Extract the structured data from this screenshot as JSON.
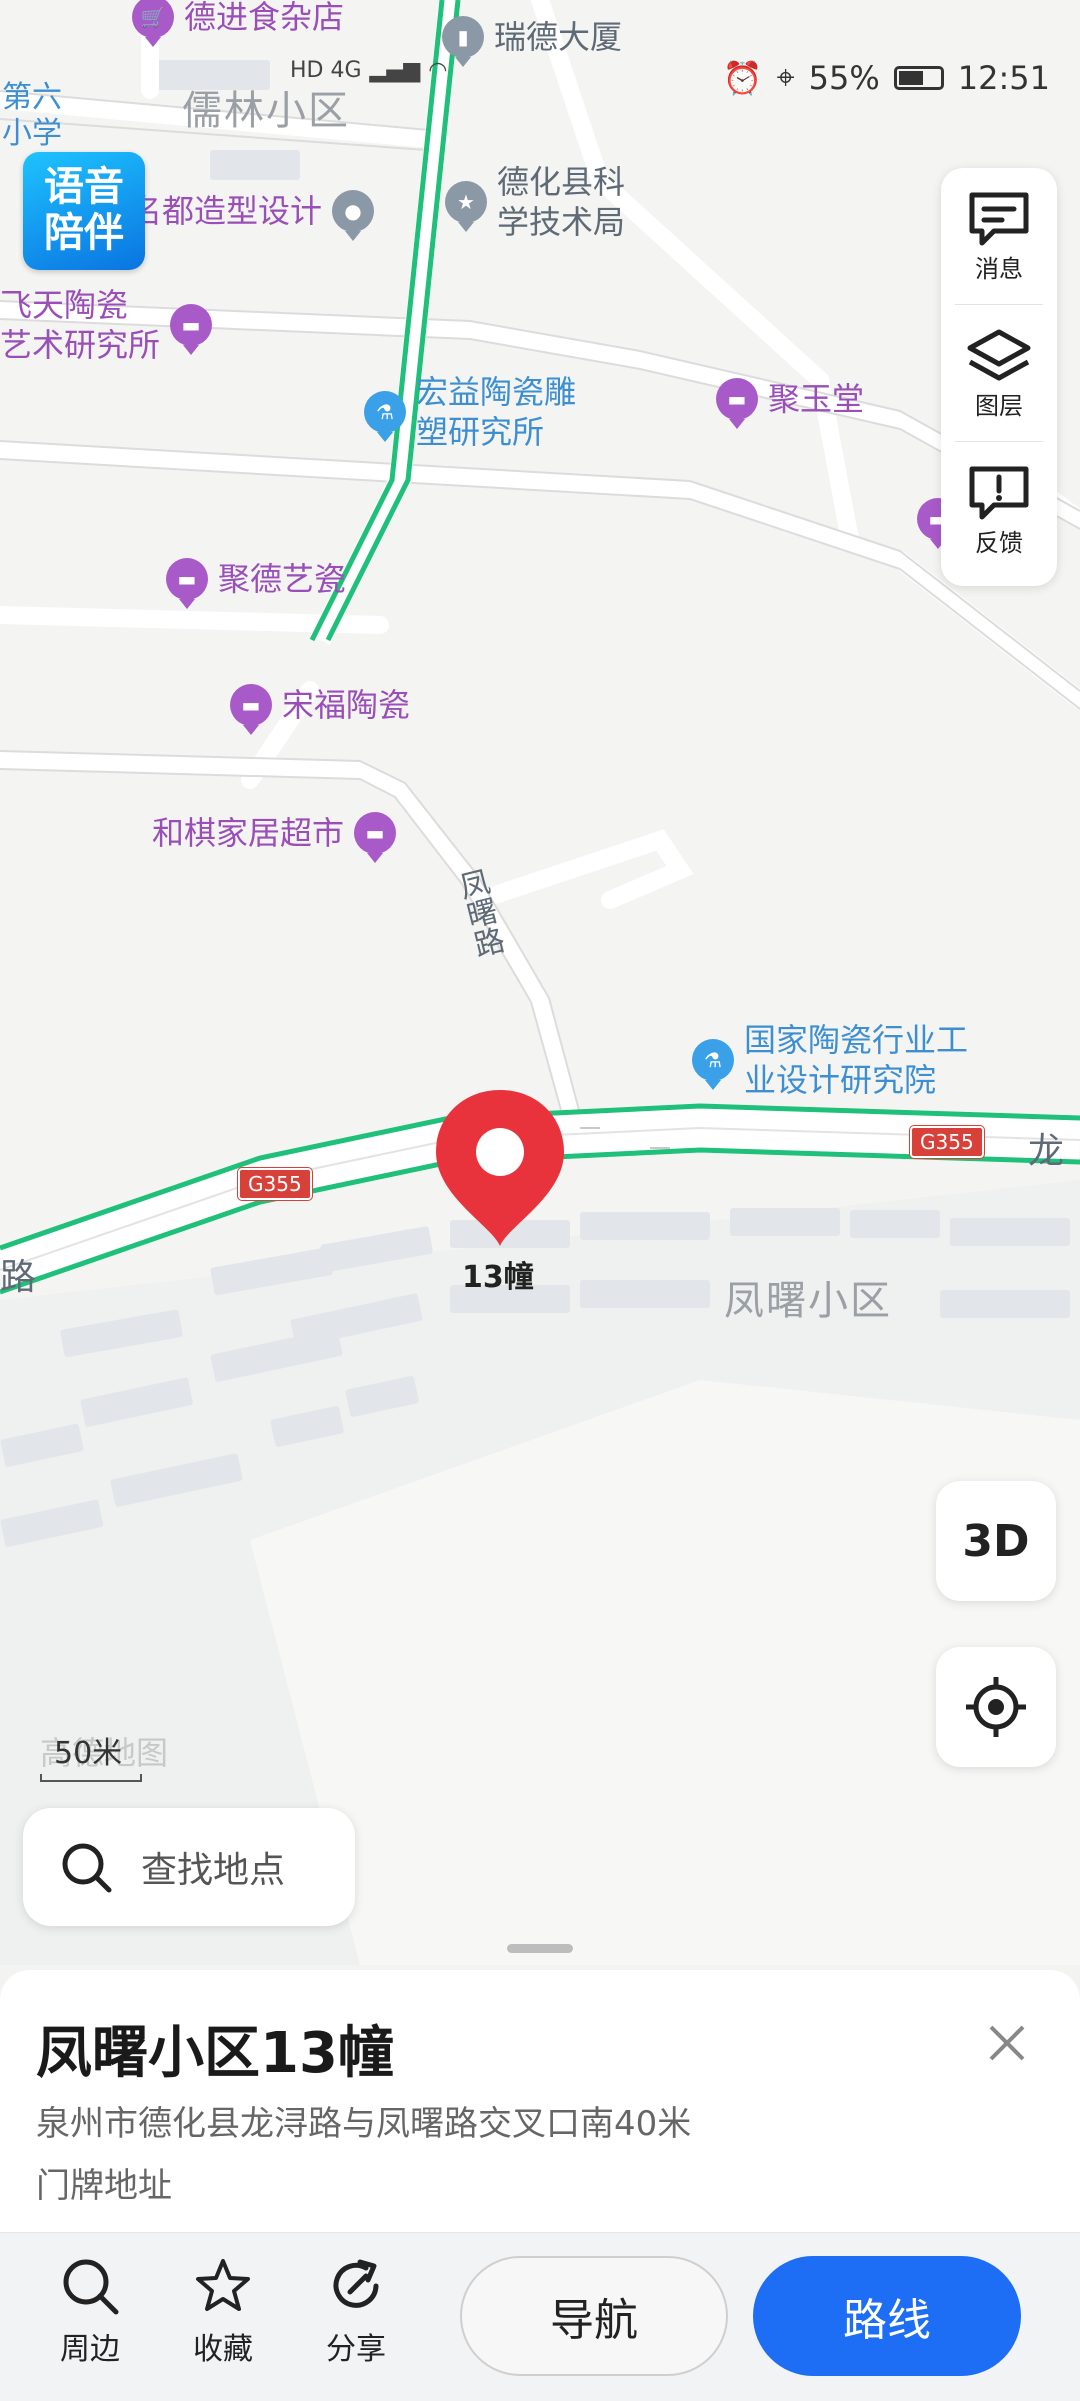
{
  "status_bar": {
    "network": "HD 4G",
    "battery": "55%",
    "time": "12:51"
  },
  "voice_companion": {
    "line1": "语音",
    "line2": "陪伴"
  },
  "right_panel": {
    "messages": "消息",
    "layers": "图层",
    "feedback": "反馈"
  },
  "map": {
    "pois": [
      {
        "name": "德进食杂店",
        "type": "shop"
      },
      {
        "name": "瑞德大厦",
        "type": "building"
      },
      {
        "name": "儒林小区",
        "type": "district"
      },
      {
        "name": "第六\n小学",
        "type": "school"
      },
      {
        "name": "名都造型设计",
        "type": "place"
      },
      {
        "name": "德化县科\n学技术局",
        "type": "gov"
      },
      {
        "name": "飞天陶瓷\n艺术研究所",
        "type": "shop"
      },
      {
        "name": "宏益陶瓷雕\n塑研究所",
        "type": "research"
      },
      {
        "name": "聚玉堂",
        "type": "shop"
      },
      {
        "name": "聚德艺瓷",
        "type": "shop"
      },
      {
        "name": "宋福陶瓷",
        "type": "shop"
      },
      {
        "name": "和棋家居超市",
        "type": "shop"
      },
      {
        "name": "国家陶瓷行业工\n业设计研究院",
        "type": "research"
      },
      {
        "name": "凤曙小区",
        "type": "district"
      }
    ],
    "roads": {
      "fengshu": "凤曙路",
      "long": "龙",
      "lu": "路",
      "highway": "G355"
    },
    "selected_marker_label": "13幢",
    "scale": "50米",
    "watermark": "高德地图"
  },
  "buttons": {
    "three_d": "3D"
  },
  "search": {
    "placeholder": "查找地点"
  },
  "detail": {
    "title": "凤曙小区13幢",
    "address": "泉州市德化县龙浔路与凤曙路交叉口南40米",
    "type": "门牌地址"
  },
  "actions": {
    "nearby": "周边",
    "favorite": "收藏",
    "share": "分享",
    "navigate": "导航",
    "route": "路线"
  }
}
